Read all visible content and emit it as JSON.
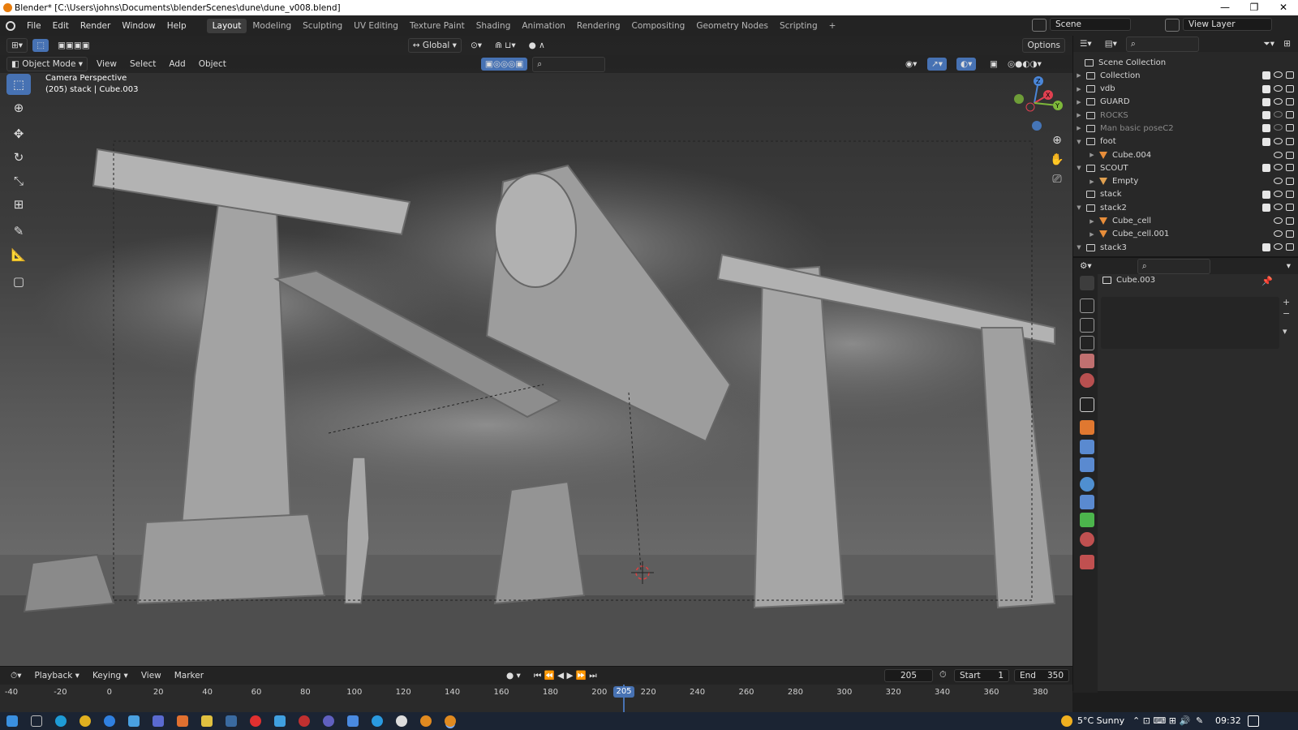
{
  "window": {
    "title": "Blender* [C:\\Users\\johns\\Documents\\blenderScenes\\dune\\dune_v008.blend]",
    "controls": [
      "—",
      "❐",
      "✕"
    ]
  },
  "menu": [
    "File",
    "Edit",
    "Render",
    "Window",
    "Help"
  ],
  "workspaces": [
    "Layout",
    "Modeling",
    "Sculpting",
    "UV Editing",
    "Texture Paint",
    "Shading",
    "Animation",
    "Rendering",
    "Compositing",
    "Geometry Nodes",
    "Scripting"
  ],
  "workspace_add": "+",
  "scene": {
    "name": "Scene",
    "view_layer": "View Layer"
  },
  "viewport": {
    "transform_orientation": "Global",
    "options_label": "Options",
    "mode": "Object Mode",
    "header_menu": [
      "View",
      "Select",
      "Add",
      "Object"
    ],
    "info_line1": "Camera Perspective",
    "info_line2": "(205) stack | Cube.003",
    "gizmo": {
      "z": "Z",
      "x": "X",
      "y": "Y"
    }
  },
  "outliner": {
    "root": "Scene Collection",
    "rows": [
      {
        "label": "Collection",
        "indent": 1,
        "expanded": false,
        "type": "collection",
        "dim": false
      },
      {
        "label": "vdb",
        "indent": 1,
        "expanded": false,
        "type": "collection",
        "dim": false
      },
      {
        "label": "GUARD",
        "indent": 1,
        "expanded": false,
        "type": "collection",
        "dim": false
      },
      {
        "label": "ROCKS",
        "indent": 1,
        "expanded": false,
        "type": "collection",
        "dim": true
      },
      {
        "label": "Man basic poseC2",
        "indent": 1,
        "expanded": false,
        "type": "collection",
        "dim": true
      },
      {
        "label": "foot",
        "indent": 1,
        "expanded": true,
        "type": "collection",
        "dim": false
      },
      {
        "label": "Cube.004",
        "indent": 2,
        "expanded": false,
        "type": "mesh",
        "dim": false
      },
      {
        "label": "SCOUT",
        "indent": 1,
        "expanded": true,
        "type": "collection",
        "dim": false
      },
      {
        "label": "Empty",
        "indent": 2,
        "expanded": false,
        "type": "empty",
        "dim": false
      },
      {
        "label": "stack",
        "indent": 1,
        "expanded": null,
        "type": "collection",
        "dim": false
      },
      {
        "label": "stack2",
        "indent": 1,
        "expanded": true,
        "type": "collection",
        "dim": false
      },
      {
        "label": "Cube_cell",
        "indent": 2,
        "expanded": false,
        "type": "mesh",
        "dim": false
      },
      {
        "label": "Cube_cell.001",
        "indent": 2,
        "expanded": false,
        "type": "mesh",
        "dim": false
      },
      {
        "label": "stack3",
        "indent": 1,
        "expanded": true,
        "type": "collection",
        "dim": false
      }
    ]
  },
  "properties": {
    "object_name": "Cube.003"
  },
  "timeline": {
    "menu": [
      "Playback",
      "Keying",
      "View",
      "Marker"
    ],
    "current_frame": "205",
    "start_label": "Start",
    "start": "1",
    "end_label": "End",
    "end": "350",
    "ticks": [
      "-40",
      "-20",
      "0",
      "20",
      "40",
      "60",
      "80",
      "100",
      "120",
      "140",
      "160",
      "180",
      "200",
      "220",
      "240",
      "260",
      "280",
      "300",
      "320",
      "340",
      "360",
      "380"
    ]
  },
  "taskbar": {
    "weather": "5°C  Sunny",
    "time": "09:32"
  }
}
